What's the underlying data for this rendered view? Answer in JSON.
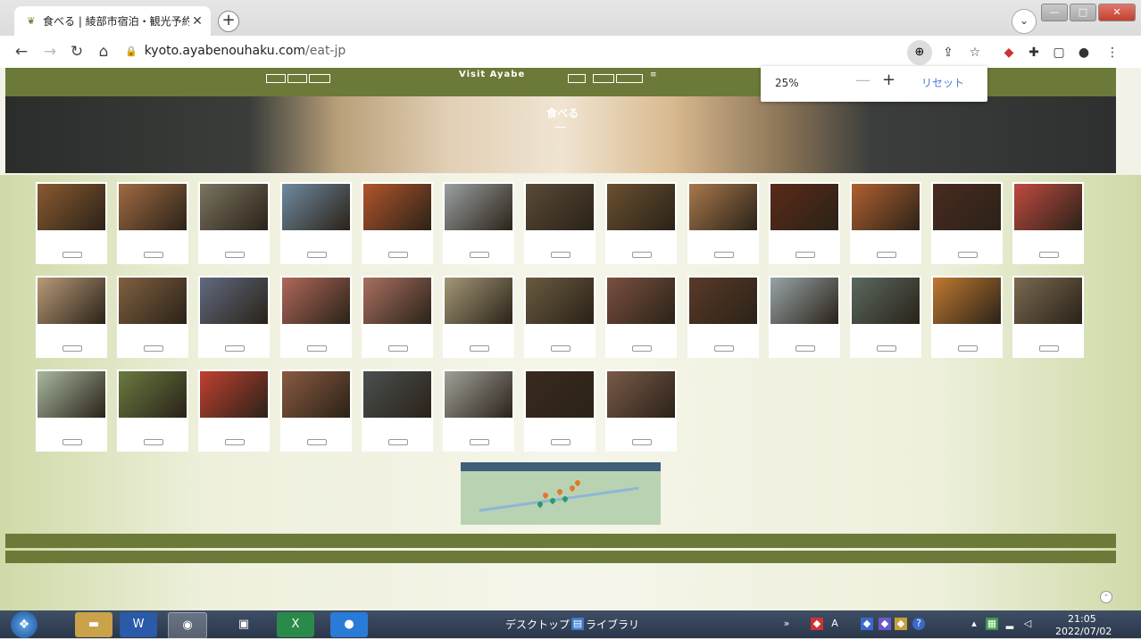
{
  "browser": {
    "tab_title": "食べる | 綾部市宿泊・観光予約",
    "new_tab": "+",
    "url_host": "kyoto.ayabenouhaku.com",
    "url_path": "/eat-jp",
    "zoom_popup": {
      "level": "25%",
      "minus": "—",
      "plus": "+",
      "reset": "リセット"
    }
  },
  "site": {
    "logo": "Visit Ayabe",
    "hero_title": "食べる"
  },
  "cards": [
    {
      "row": 0,
      "col": 0,
      "photo": "#8a5a30"
    },
    {
      "row": 0,
      "col": 1,
      "photo": "#a06a42"
    },
    {
      "row": 0,
      "col": 2,
      "photo": "#7a7460"
    },
    {
      "row": 0,
      "col": 3,
      "photo": "#6f8aa0"
    },
    {
      "row": 0,
      "col": 4,
      "photo": "#b2552a"
    },
    {
      "row": 0,
      "col": 5,
      "photo": "#9aa0a2"
    },
    {
      "row": 0,
      "col": 6,
      "photo": "#5a4a38"
    },
    {
      "row": 0,
      "col": 7,
      "photo": "#6a5030"
    },
    {
      "row": 0,
      "col": 8,
      "photo": "#a8784c"
    },
    {
      "row": 0,
      "col": 9,
      "photo": "#5a2a18"
    },
    {
      "row": 0,
      "col": 10,
      "photo": "#b06030"
    },
    {
      "row": 0,
      "col": 11,
      "photo": "#4a2a20"
    },
    {
      "row": 0,
      "col": 12,
      "photo": "#c04a40"
    },
    {
      "row": 1,
      "col": 0,
      "photo": "#b89a78"
    },
    {
      "row": 1,
      "col": 1,
      "photo": "#806040"
    },
    {
      "row": 1,
      "col": 2,
      "photo": "#606a80"
    },
    {
      "row": 1,
      "col": 3,
      "photo": "#b0685a"
    },
    {
      "row": 1,
      "col": 4,
      "photo": "#a87060"
    },
    {
      "row": 1,
      "col": 5,
      "photo": "#a49878"
    },
    {
      "row": 1,
      "col": 6,
      "photo": "#6a5a40"
    },
    {
      "row": 1,
      "col": 7,
      "photo": "#7a5040"
    },
    {
      "row": 1,
      "col": 8,
      "photo": "#5a3a28"
    },
    {
      "row": 1,
      "col": 9,
      "photo": "#98a4a8"
    },
    {
      "row": 1,
      "col": 10,
      "photo": "#5a6a60"
    },
    {
      "row": 1,
      "col": 11,
      "photo": "#c07a30"
    },
    {
      "row": 1,
      "col": 12,
      "photo": "#7a6a50"
    },
    {
      "row": 2,
      "col": 0,
      "photo": "#a8b8a0"
    },
    {
      "row": 2,
      "col": 1,
      "photo": "#6a7a40"
    },
    {
      "row": 2,
      "col": 2,
      "photo": "#c04030"
    },
    {
      "row": 2,
      "col": 3,
      "photo": "#8a5a40"
    },
    {
      "row": 2,
      "col": 4,
      "photo": "#4a5050"
    },
    {
      "row": 2,
      "col": 5,
      "photo": "#a0a098"
    },
    {
      "row": 2,
      "col": 6,
      "photo": "#3a2a20"
    },
    {
      "row": 2,
      "col": 7,
      "photo": "#7a5a48"
    }
  ],
  "taskbar": {
    "desktop_label": "デスクトップ",
    "library_label": "ライブラリ",
    "time": "21:05",
    "date": "2022/07/02"
  },
  "colors": {
    "site_green": "#6b7a38",
    "accent_blue": "#4a7bd0"
  }
}
